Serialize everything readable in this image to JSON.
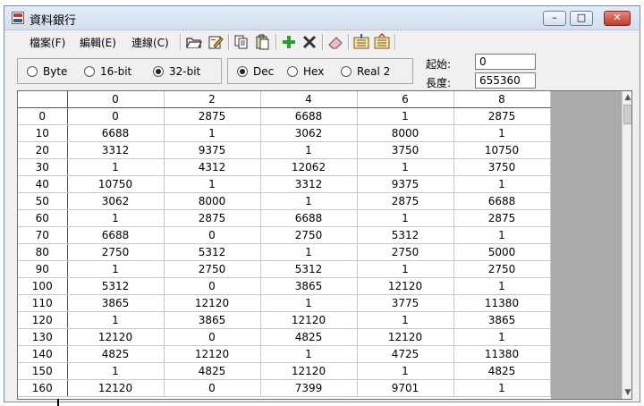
{
  "window": {
    "title": "資料銀行"
  },
  "menu": [
    {
      "label": "檔案(F)"
    },
    {
      "label": "編輯(E)"
    },
    {
      "label": "連線(C)"
    }
  ],
  "toolbar": [
    {
      "icon": "open-folder-icon"
    },
    {
      "icon": "edit-document-icon"
    },
    {
      "icon": "copy-icon"
    },
    {
      "icon": "paste-icon"
    },
    {
      "icon": "add-icon"
    },
    {
      "icon": "delete-icon"
    },
    {
      "icon": "eraser-icon"
    },
    {
      "icon": "import-icon"
    },
    {
      "icon": "export-icon"
    }
  ],
  "data_size": {
    "options": [
      "Byte",
      "16-bit",
      "32-bit"
    ],
    "selected": "32-bit"
  },
  "format": {
    "options": [
      "Dec",
      "Hex",
      "Real 2"
    ],
    "selected": "Dec"
  },
  "start": {
    "label": "起始:",
    "value": "0"
  },
  "length": {
    "label": "長度:",
    "value": "655360"
  },
  "grid": {
    "columns": [
      "0",
      "2",
      "4",
      "6",
      "8"
    ],
    "rows": [
      {
        "addr": "0",
        "cells": [
          "0",
          "2875",
          "6688",
          "1",
          "2875"
        ]
      },
      {
        "addr": "10",
        "cells": [
          "6688",
          "1",
          "3062",
          "8000",
          "1"
        ]
      },
      {
        "addr": "20",
        "cells": [
          "3312",
          "9375",
          "1",
          "3750",
          "10750"
        ]
      },
      {
        "addr": "30",
        "cells": [
          "1",
          "4312",
          "12062",
          "1",
          "3750"
        ]
      },
      {
        "addr": "40",
        "cells": [
          "10750",
          "1",
          "3312",
          "9375",
          "1"
        ]
      },
      {
        "addr": "50",
        "cells": [
          "3062",
          "8000",
          "1",
          "2875",
          "6688"
        ]
      },
      {
        "addr": "60",
        "cells": [
          "1",
          "2875",
          "6688",
          "1",
          "2875"
        ]
      },
      {
        "addr": "70",
        "cells": [
          "6688",
          "0",
          "2750",
          "5312",
          "1"
        ]
      },
      {
        "addr": "80",
        "cells": [
          "2750",
          "5312",
          "1",
          "2750",
          "5000"
        ]
      },
      {
        "addr": "90",
        "cells": [
          "1",
          "2750",
          "5312",
          "1",
          "2750"
        ]
      },
      {
        "addr": "100",
        "cells": [
          "5312",
          "0",
          "3865",
          "12120",
          "1"
        ]
      },
      {
        "addr": "110",
        "cells": [
          "3865",
          "12120",
          "1",
          "3775",
          "11380"
        ]
      },
      {
        "addr": "120",
        "cells": [
          "1",
          "3865",
          "12120",
          "1",
          "3865"
        ]
      },
      {
        "addr": "130",
        "cells": [
          "12120",
          "0",
          "4825",
          "12120",
          "1"
        ]
      },
      {
        "addr": "140",
        "cells": [
          "4825",
          "12120",
          "1",
          "4725",
          "11380"
        ]
      },
      {
        "addr": "150",
        "cells": [
          "1",
          "4825",
          "12120",
          "1",
          "4825"
        ]
      },
      {
        "addr": "160",
        "cells": [
          "12120",
          "0",
          "7399",
          "9701",
          "1"
        ]
      }
    ]
  }
}
